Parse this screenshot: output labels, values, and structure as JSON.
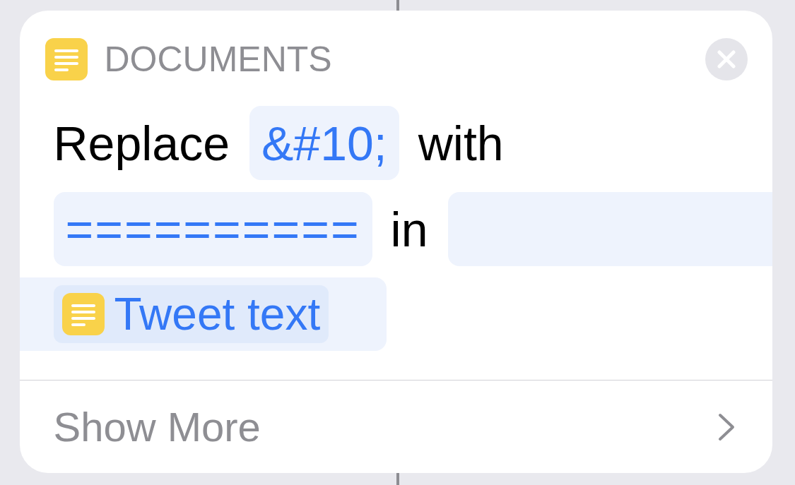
{
  "header": {
    "category": "DOCUMENTS"
  },
  "action": {
    "verb": "Replace",
    "find": "&#10;",
    "connector_1": "with",
    "replacement": "==========",
    "connector_2": "in",
    "input": {
      "variable": "Tweet text"
    }
  },
  "footer": {
    "label": "Show More"
  }
}
